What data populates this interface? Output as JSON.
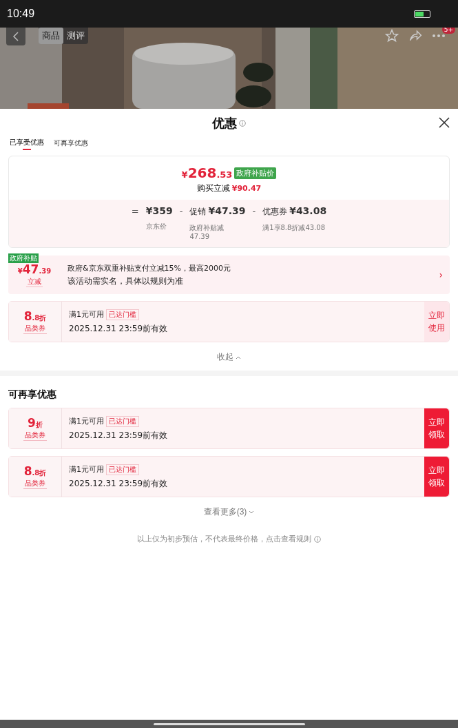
{
  "status_bar": {
    "time": "10:49"
  },
  "product_nav": {
    "tabs": [
      {
        "label": "商品",
        "selected": true
      },
      {
        "label": "测评",
        "selected": false
      }
    ],
    "badge": "5+"
  },
  "sheet": {
    "title": "优惠",
    "tabs": [
      {
        "label": "已享受优惠",
        "selected": true
      },
      {
        "label": "可再享优惠",
        "selected": false
      }
    ],
    "price_card": {
      "final_price": {
        "symbol": "¥",
        "integer": "268",
        "decimal": ".53"
      },
      "price_tag": "政府补贴价",
      "reduction_label": "购买立减",
      "reduction": "¥90.47",
      "breakdown": [
        {
          "operator": "=",
          "amount": "¥359",
          "note": "京东价"
        },
        {
          "operator": "-",
          "label": "促销",
          "amount": "¥47.39",
          "note": "政府补贴减47.39"
        },
        {
          "operator": "-",
          "label": "优惠券",
          "amount": "¥43.08",
          "note": "满1享8.8折减43.08"
        }
      ]
    },
    "subsidy": {
      "tag": "政府补贴",
      "symbol": "¥",
      "integer": "47",
      "decimal": ".39",
      "unit": "立减",
      "line1": "政府&京东双重补贴支付立减15%，最高2000元",
      "line2": "该活动需实名，具体以规则为准",
      "chevron": "›"
    },
    "applied_coupons": [
      {
        "value": "8",
        "fraction": ".8",
        "unit": "折",
        "type": "品类券",
        "condition": "满1元可用",
        "threshold": "已达门槛",
        "expiry": "2025.12.31 23:59前有效",
        "action": {
          "kind": "use",
          "label": "立即使用"
        }
      }
    ],
    "collapse": "收起",
    "more_section": {
      "title": "可再享优惠",
      "coupons": [
        {
          "value": "9",
          "unit": "折",
          "type": "品类券",
          "condition": "满1元可用",
          "threshold": "已达门槛",
          "expiry": "2025.12.31 23:59前有效",
          "action": {
            "kind": "claim",
            "label": "立即领取"
          }
        },
        {
          "value": "8",
          "fraction": ".8",
          "unit": "折",
          "type": "品类券",
          "condition": "满1元可用",
          "threshold": "已达门槛",
          "expiry": "2025.12.31 23:59前有效",
          "action": {
            "kind": "claim",
            "label": "立即领取"
          }
        }
      ],
      "see_more": "查看更多(3)"
    },
    "footnote": "以上仅为初步预估，不代表最终价格，点击查看规则"
  }
}
